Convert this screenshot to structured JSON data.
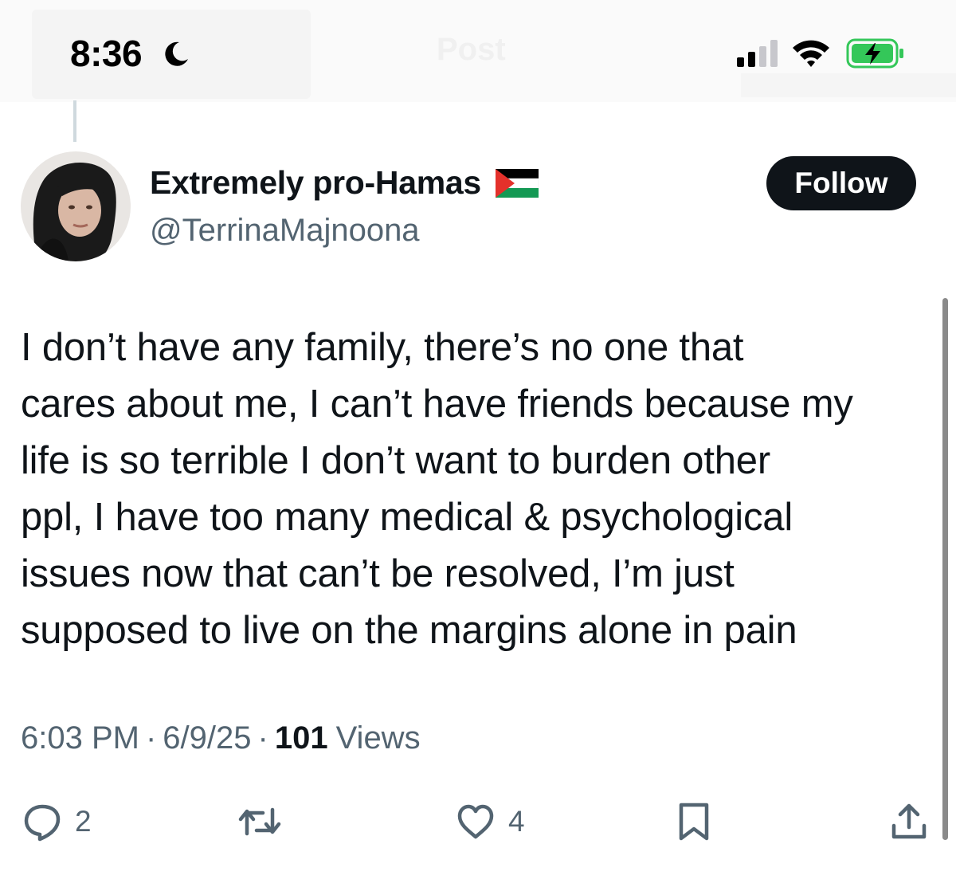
{
  "status_bar": {
    "time": "8:36"
  },
  "background_header": {
    "title": "Post"
  },
  "author": {
    "display_name": "Extremely pro-Hamas",
    "handle": "@TerrinaMajnoona",
    "flag": "palestine-flag"
  },
  "follow_label": "Follow",
  "tweet": {
    "text": "I don’t have any family, there’s no one that\ncares about me, I can’t have friends because my\nlife is so terrible I don’t want to burden other\nppl, I have too many medical & psychological\nissues now that can’t be resolved, I’m just\nsupposed to live on the margins alone in pain"
  },
  "meta": {
    "time": "6:03 PM",
    "date": "6/9/25",
    "views_count": "101",
    "views_label": "Views",
    "separator": "·"
  },
  "actions": {
    "reply_count": "2",
    "like_count": "4"
  },
  "colors": {
    "text": "#0f1419",
    "secondary": "#536471",
    "button_bg": "#0f1419",
    "battery_green": "#34c759"
  },
  "icons": [
    "moon-icon",
    "signal-icon",
    "wifi-icon",
    "battery-icon",
    "reply-icon",
    "retweet-icon",
    "heart-icon",
    "bookmark-icon",
    "share-icon"
  ]
}
